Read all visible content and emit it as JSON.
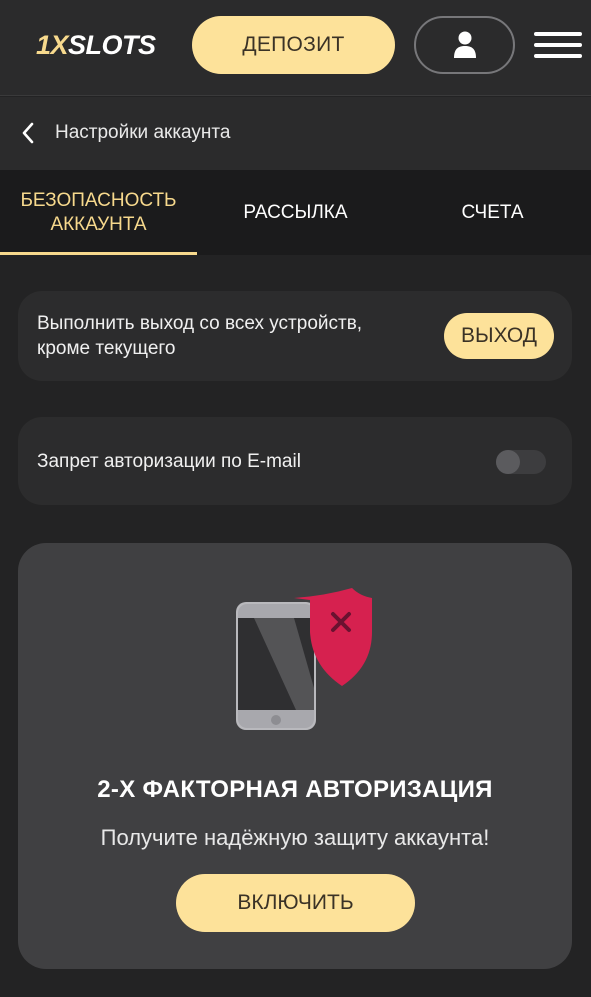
{
  "header": {
    "logo_part1": "1X",
    "logo_part2": "SLOTS",
    "deposit_label": "ДЕПОЗИТ",
    "profile_icon": "user-icon",
    "menu_icon": "hamburger-icon"
  },
  "breadcrumb": {
    "back_icon": "chevron-left-icon",
    "title": "Настройки аккаунта"
  },
  "tabs": [
    {
      "label_line1": "БЕЗОПАСНОСТЬ",
      "label_line2": "АККАУНТА",
      "active": true
    },
    {
      "label": "РАССЫЛКА",
      "active": false
    },
    {
      "label": "СЧЕТА",
      "active": false
    }
  ],
  "logout": {
    "text_line1": "Выполнить выход со всех устройств,",
    "text_line2": "кроме текущего",
    "button_label": "ВЫХОД"
  },
  "email_ban": {
    "text": "Запрет авторизации по E-mail",
    "enabled": false
  },
  "twofa": {
    "illustration_icon": "phone-shield-icon",
    "title": "2-Х ФАКТОРНАЯ АВТОРИЗАЦИЯ",
    "subtitle": "Получите надёжную защиту аккаунта!",
    "button_label": "ВКЛЮЧИТЬ"
  },
  "colors": {
    "accent": "#fde29a",
    "active_tab": "#f7d98d",
    "background": "#232324",
    "card": "#2c2c2d",
    "shield": "#d6214f"
  }
}
